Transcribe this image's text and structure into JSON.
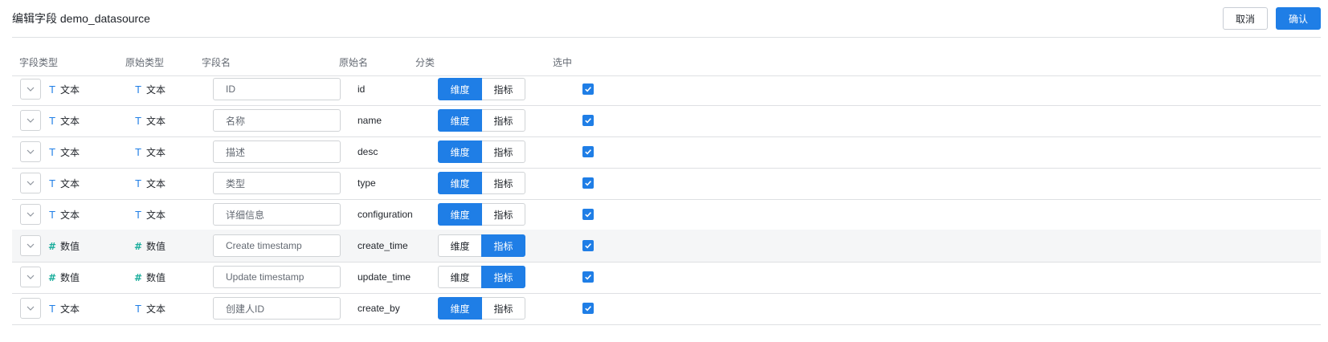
{
  "header": {
    "title": "编辑字段 demo_datasource",
    "cancel_label": "取消",
    "confirm_label": "确认"
  },
  "columns": {
    "field_type": "字段类型",
    "original_type": "原始类型",
    "field_name": "字段名",
    "original_name": "原始名",
    "category": "分类",
    "selected": "选中"
  },
  "category_options": {
    "dimension": "维度",
    "metric": "指标"
  },
  "icons": {
    "text_type": "text-type-icon",
    "number_type": "number-type-icon",
    "dropdown": "chevron-down-icon",
    "check": "checkbox-checked-icon"
  },
  "colors": {
    "accent": "#1f7ee6",
    "number_icon": "#1cae9d",
    "border": "#dee0e3"
  },
  "rows": [
    {
      "field_type": "文本",
      "original_type": "文本",
      "field_name": "ID",
      "original_name": "id",
      "category": "dimension",
      "selected": true
    },
    {
      "field_type": "文本",
      "original_type": "文本",
      "field_name": "名称",
      "original_name": "name",
      "category": "dimension",
      "selected": true
    },
    {
      "field_type": "文本",
      "original_type": "文本",
      "field_name": "描述",
      "original_name": "desc",
      "category": "dimension",
      "selected": true
    },
    {
      "field_type": "文本",
      "original_type": "文本",
      "field_name": "类型",
      "original_name": "type",
      "category": "dimension",
      "selected": true
    },
    {
      "field_type": "文本",
      "original_type": "文本",
      "field_name": "详细信息",
      "original_name": "configuration",
      "category": "dimension",
      "selected": true
    },
    {
      "field_type": "数值",
      "original_type": "数值",
      "field_name": "Create timestamp",
      "original_name": "create_time",
      "category": "metric",
      "selected": true,
      "highlighted": true
    },
    {
      "field_type": "数值",
      "original_type": "数值",
      "field_name": "Update timestamp",
      "original_name": "update_time",
      "category": "metric",
      "selected": true
    },
    {
      "field_type": "文本",
      "original_type": "文本",
      "field_name": "创建人ID",
      "original_name": "create_by",
      "category": "dimension",
      "selected": true
    }
  ]
}
